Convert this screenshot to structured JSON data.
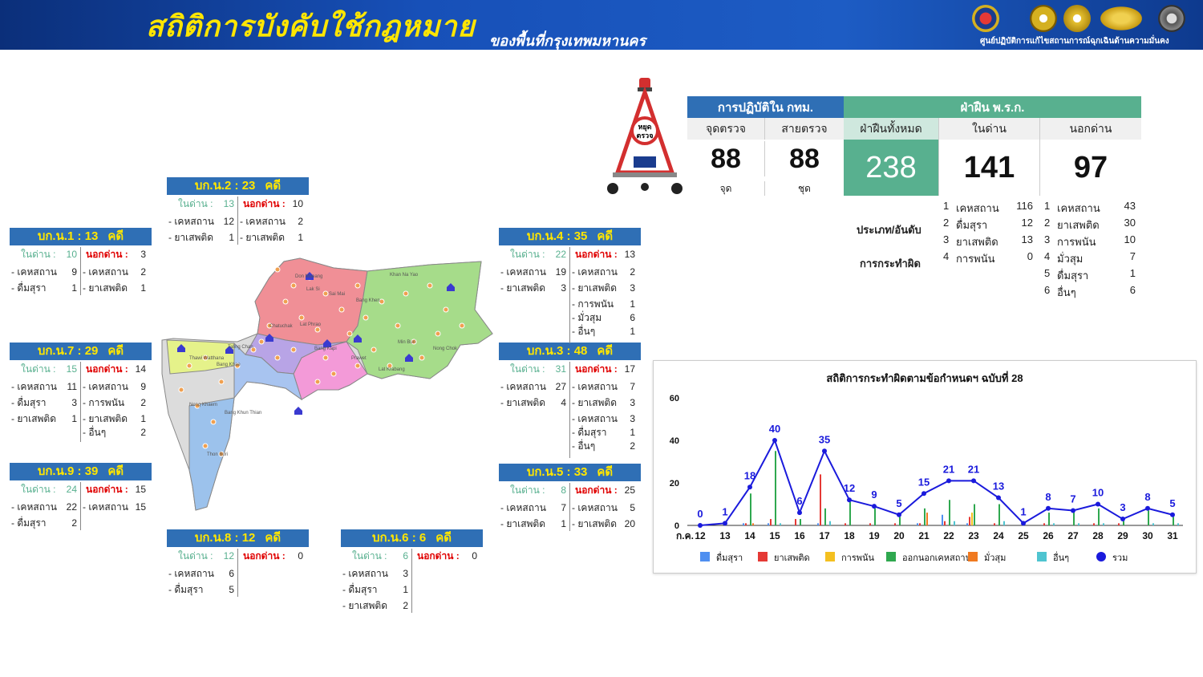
{
  "header": {
    "title": "สถิติการบังคับใช้กฎหมาย",
    "subtitle": "ของพื้นที่กรุงเทพมหานคร",
    "org": "ศูนย์ปฏิบัติการแก้ไขสถานการณ์ฉุกเฉินด้านความมั่นคง"
  },
  "sign_text": "หยุดตรวจ",
  "summary": {
    "ops_title": "การปฏิบัติใน กทม.",
    "violations_title": "ฝ่าฝืน พ.ร.ก.",
    "checkpoints_label": "จุดตรวจ",
    "patrols_label": "สายตรวจ",
    "total_label": "ฝ่าฝืนทั้งหมด",
    "inside_label": "ในด่าน",
    "outside_label": "นอกด่าน",
    "checkpoints": "88",
    "checkpoints_unit": "จุด",
    "patrols": "88",
    "patrols_unit": "ชุด",
    "total": "238",
    "inside": "141",
    "outside": "97"
  },
  "category": {
    "label1": "ประเภท/อันดับ",
    "label2": "การกระทำผิด",
    "inside": [
      {
        "rank": "1",
        "name": "เคหสถาน",
        "count": "116"
      },
      {
        "rank": "2",
        "name": "ดื่มสุรา",
        "count": "12"
      },
      {
        "rank": "3",
        "name": "ยาเสพติด",
        "count": "13"
      },
      {
        "rank": "4",
        "name": "การพนัน",
        "count": "0"
      }
    ],
    "outside": [
      {
        "rank": "1",
        "name": "เคหสถาน",
        "count": "43"
      },
      {
        "rank": "2",
        "name": "ยาเสพติด",
        "count": "30"
      },
      {
        "rank": "3",
        "name": "การพนัน",
        "count": "10"
      },
      {
        "rank": "4",
        "name": "มั่วสุม",
        "count": "7"
      },
      {
        "rank": "5",
        "name": "ดื่มสุรา",
        "count": "1"
      },
      {
        "rank": "6",
        "name": "อื่นๆ",
        "count": "6"
      }
    ]
  },
  "in_label": "ในด่าน :",
  "out_label": "นอกด่าน :",
  "case_unit": "คดี",
  "districts": {
    "b1": {
      "name": "บก.น.1",
      "cases": "13",
      "in": "10",
      "out": "3",
      "in_items": [
        {
          "n": "- เคหสถาน",
          "v": "9"
        },
        {
          "n": "- ดื่มสุรา",
          "v": "1"
        }
      ],
      "out_items": [
        {
          "n": "- เคหสถาน",
          "v": "2"
        },
        {
          "n": "- ยาเสพติด",
          "v": "1"
        }
      ]
    },
    "b2": {
      "name": "บก.น.2",
      "cases": "23",
      "in": "13",
      "out": "10",
      "in_items": [
        {
          "n": "- เคหสถาน",
          "v": "12"
        },
        {
          "n": "- ยาเสพติด",
          "v": "1"
        }
      ],
      "out_items": [
        {
          "n": "- เคหสถาน",
          "v": "2"
        },
        {
          "n": "- ยาเสพติด",
          "v": "1"
        }
      ]
    },
    "b3": {
      "name": "บก.น.3",
      "cases": "48",
      "in": "31",
      "out": "17",
      "in_items": [
        {
          "n": "- เคหสถาน",
          "v": "27"
        },
        {
          "n": "- ยาเสพติด",
          "v": "4"
        }
      ],
      "out_items": [
        {
          "n": "- เคหสถาน",
          "v": "7"
        },
        {
          "n": "- ยาเสพติด",
          "v": "3"
        },
        {
          "n": "- เคหสถาน",
          "v": "3"
        },
        {
          "n": "- ดื่มสุรา",
          "v": "1"
        },
        {
          "n": "- อื่นๆ",
          "v": "2"
        }
      ]
    },
    "b4": {
      "name": "บก.น.4",
      "cases": "35",
      "in": "22",
      "out": "13",
      "in_items": [
        {
          "n": "- เคหสถาน",
          "v": "19"
        },
        {
          "n": "- ยาเสพติด",
          "v": "3"
        }
      ],
      "out_items": [
        {
          "n": "- เคหสถาน",
          "v": "2"
        },
        {
          "n": "- ยาเสพติด",
          "v": "3"
        },
        {
          "n": "- การพนัน",
          "v": "1"
        },
        {
          "n": "- มั่วสุม",
          "v": "6"
        },
        {
          "n": "- อื่นๆ",
          "v": "1"
        }
      ]
    },
    "b5": {
      "name": "บก.น.5",
      "cases": "33",
      "in": "8",
      "out": "25",
      "in_items": [
        {
          "n": "- เคหสถาน",
          "v": "7"
        },
        {
          "n": "- ยาเสพติด",
          "v": "1"
        }
      ],
      "out_items": [
        {
          "n": "- เคหสถาน",
          "v": "5"
        },
        {
          "n": "- ยาเสพติด",
          "v": "20"
        }
      ]
    },
    "b6": {
      "name": "บก.น.6",
      "cases": "6",
      "in": "6",
      "out": "0",
      "in_items": [
        {
          "n": "- เคหสถาน",
          "v": "3"
        },
        {
          "n": "- ดื่มสุรา",
          "v": "1"
        },
        {
          "n": "- ยาเสพติด",
          "v": "2"
        }
      ],
      "out_items": []
    },
    "b7": {
      "name": "บก.น.7",
      "cases": "29",
      "in": "15",
      "out": "14",
      "in_items": [
        {
          "n": "- เคหสถาน",
          "v": "11"
        },
        {
          "n": "- ดื่มสุรา",
          "v": "3"
        },
        {
          "n": "- ยาเสพติด",
          "v": "1"
        }
      ],
      "out_items": [
        {
          "n": "- เคหสถาน",
          "v": "9"
        },
        {
          "n": "- การพนัน",
          "v": "2"
        },
        {
          "n": "- ยาเสพติด",
          "v": "1"
        },
        {
          "n": "- อื่นๆ",
          "v": "2"
        }
      ]
    },
    "b8": {
      "name": "บก.น.8",
      "cases": "12",
      "in": "12",
      "out": "0",
      "in_items": [
        {
          "n": "- เคหสถาน",
          "v": "6"
        },
        {
          "n": "- ดื่มสุรา",
          "v": "5"
        }
      ],
      "out_items": []
    },
    "b9": {
      "name": "บก.น.9",
      "cases": "39",
      "in": "24",
      "out": "15",
      "in_items": [
        {
          "n": "- เคหสถาน",
          "v": "22"
        },
        {
          "n": "- ดื่มสุรา",
          "v": "2"
        }
      ],
      "out_items": [
        {
          "n": "- เคหสถาน",
          "v": "15"
        }
      ]
    }
  },
  "map_labels": [
    "Don Mueang",
    "Lak Si",
    "Sai Mai",
    "Bang Khen",
    "Khan Na Yao",
    "Min Buri",
    "Nong Chok",
    "Lat Krabang",
    "Prawet",
    "Bang Kapi",
    "Lat Phrao",
    "Chatuchak",
    "Taling Chan",
    "Thawi Watthana",
    "Bang Khae",
    "Nong Khaem",
    "Bang Khun Thian",
    "Thon Buri"
  ],
  "chart_data": {
    "type": "line",
    "title": "สถิติการกระทำผิดตามข้อกำหนดฯ ฉบับที่ 28",
    "xlabel": "ก.ค.",
    "ylim": [
      0,
      60
    ],
    "yticks": [
      "0",
      "20",
      "40",
      "60"
    ],
    "categories": [
      "12",
      "13",
      "14",
      "15",
      "16",
      "17",
      "18",
      "19",
      "20",
      "21",
      "22",
      "23",
      "24",
      "25",
      "26",
      "27",
      "28",
      "29",
      "30",
      "31"
    ],
    "line_series": {
      "name": "รวม",
      "color": "#1a1adc",
      "values": [
        0,
        1,
        18,
        40,
        6,
        35,
        12,
        9,
        5,
        15,
        21,
        21,
        13,
        1,
        8,
        7,
        10,
        3,
        8,
        5
      ]
    },
    "bar_series": [
      {
        "name": "ดื่มสุรา",
        "color": "#4f8ff0",
        "values": [
          0,
          0,
          1,
          1,
          0,
          1,
          0,
          0,
          0,
          1,
          5,
          1,
          0,
          0,
          0,
          0,
          0,
          0,
          0,
          0
        ]
      },
      {
        "name": "ยาเสพติด",
        "color": "#e53935",
        "values": [
          0,
          0,
          1,
          3,
          3,
          24,
          1,
          1,
          1,
          1,
          2,
          4,
          1,
          0,
          1,
          0,
          1,
          1,
          0,
          0
        ]
      },
      {
        "name": "การพนัน",
        "color": "#f4c020",
        "values": [
          0,
          0,
          0,
          0,
          0,
          0,
          0,
          0,
          0,
          0,
          0,
          6,
          0,
          0,
          0,
          0,
          0,
          0,
          0,
          0
        ]
      },
      {
        "name": "ออกนอกเคหสถาน",
        "color": "#2fa84f",
        "values": [
          0,
          1,
          15,
          35,
          3,
          8,
          11,
          8,
          4,
          8,
          12,
          10,
          10,
          1,
          6,
          6,
          8,
          2,
          7,
          4
        ]
      },
      {
        "name": "มั่วสุม",
        "color": "#f07a20",
        "values": [
          0,
          0,
          1,
          0,
          0,
          0,
          0,
          0,
          0,
          6,
          0,
          0,
          0,
          0,
          0,
          0,
          0,
          0,
          0,
          0
        ]
      },
      {
        "name": "อื่นๆ",
        "color": "#4fc4d0",
        "values": [
          0,
          0,
          0,
          1,
          0,
          2,
          0,
          0,
          0,
          0,
          2,
          0,
          2,
          0,
          1,
          1,
          1,
          0,
          1,
          1
        ]
      }
    ]
  }
}
